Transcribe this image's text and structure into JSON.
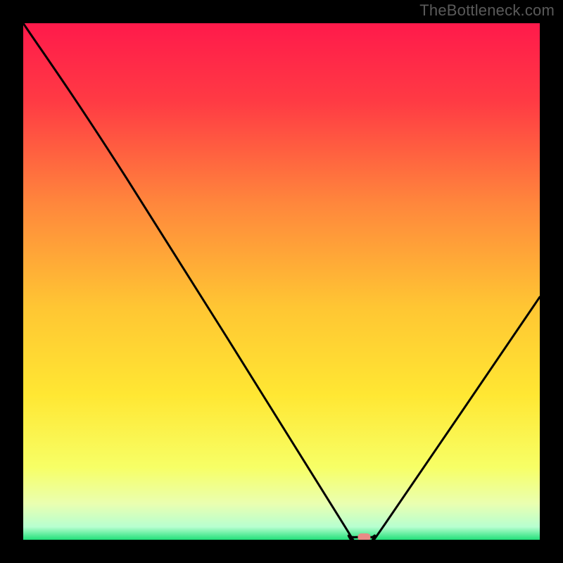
{
  "watermark": "TheBottleneck.com",
  "chart_data": {
    "type": "line",
    "title": "",
    "xlabel": "",
    "ylabel": "",
    "xlim": [
      0,
      100
    ],
    "ylim": [
      0,
      100
    ],
    "x": [
      0,
      20,
      62,
      63,
      65,
      67,
      68,
      70,
      100
    ],
    "values": [
      100,
      70,
      3,
      0.8,
      0.5,
      0.5,
      0.8,
      3,
      47
    ],
    "optimum_marker": {
      "x": 66,
      "y": 0.5
    },
    "gradient_stops": [
      {
        "offset": 0.0,
        "color": "#ff1a4b"
      },
      {
        "offset": 0.15,
        "color": "#ff3a44"
      },
      {
        "offset": 0.35,
        "color": "#ff873c"
      },
      {
        "offset": 0.55,
        "color": "#ffc633"
      },
      {
        "offset": 0.72,
        "color": "#ffe733"
      },
      {
        "offset": 0.86,
        "color": "#f7ff66"
      },
      {
        "offset": 0.93,
        "color": "#eaffb0"
      },
      {
        "offset": 0.975,
        "color": "#b7ffd0"
      },
      {
        "offset": 1.0,
        "color": "#22e07a"
      }
    ]
  }
}
